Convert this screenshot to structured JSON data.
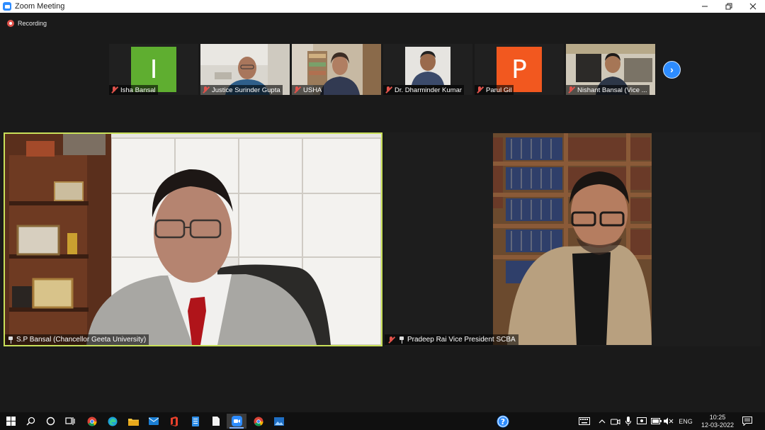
{
  "window": {
    "title": "Zoom Meeting",
    "controls": [
      "minimize",
      "restore",
      "close"
    ]
  },
  "recording": {
    "label": "Recording",
    "color": "#e0524b"
  },
  "gallery": {
    "participants": [
      {
        "name": "Isha Bansal",
        "initial": "I",
        "tile_color": "#5fae30",
        "video": false,
        "muted": true
      },
      {
        "name": "Justice Surinder Gupta",
        "video": true,
        "muted": true
      },
      {
        "name": "USHA",
        "video": true,
        "muted": true
      },
      {
        "name": "Dr. Dharminder Kumar",
        "video": true,
        "muted": true
      },
      {
        "name": "Parul Gil",
        "initial": "P",
        "tile_color": "#f2581f",
        "video": false,
        "muted": true
      },
      {
        "name": "Nishant Bansal (Vice ...",
        "video": true,
        "muted": true
      }
    ],
    "next_icon": "chevron-right-icon"
  },
  "speakers": {
    "left": {
      "name": "S.P Bansal (Chancellor Geeta University)",
      "pinned": true,
      "active_speaker": true,
      "highlight_color": "#c9e05a"
    },
    "right": {
      "name": "Pradeep Rai Vice President SCBA",
      "pinned": true,
      "muted": true
    }
  },
  "taskbar": {
    "apps": [
      "windows-start-icon",
      "search-icon",
      "cortana-icon",
      "task-view-icon",
      "chrome-icon",
      "edge-icon",
      "file-explorer-icon",
      "mail-icon",
      "office-icon",
      "document-icon",
      "file-icon",
      "zoom-icon",
      "chrome-icon",
      "photos-icon"
    ],
    "help_icon": "help-icon",
    "tray_icons": [
      "keyboard-icon",
      "chevron-up-icon",
      "meet-now-icon",
      "microphone-icon",
      "screen-capture-icon",
      "battery-icon",
      "volume-muted-icon"
    ],
    "language": "ENG",
    "time": "10:25",
    "date": "12-03-2022",
    "notification_icon": "notification-icon"
  }
}
